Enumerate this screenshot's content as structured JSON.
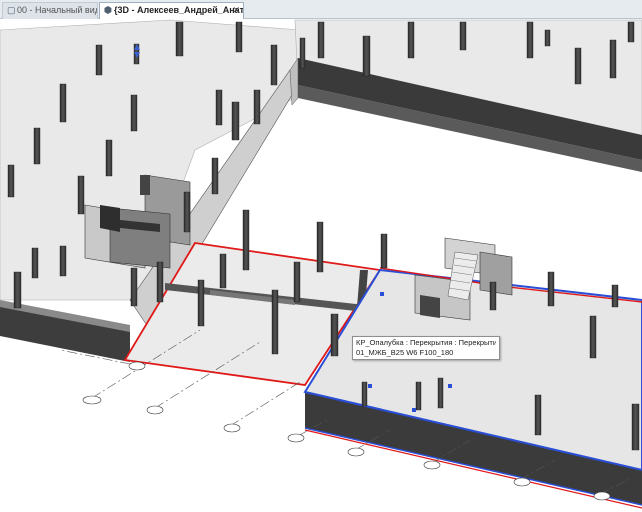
{
  "tabs": [
    {
      "label": "00 - Начальный вид",
      "icon": "view-icon",
      "active": false
    },
    {
      "label": "{3D - Алексеев_Андрей_Анатол...",
      "icon": "3d-view-icon",
      "active": true
    }
  ],
  "tooltip": {
    "line1": "КР_Опалубка : Перекрытия : Перекрытие :",
    "line2": "01_МЖБ_B25 W6 F100_180"
  },
  "colors": {
    "selection_red": "#e01818",
    "highlight_blue": "#2a4fd6",
    "wall_dark": "#3d3d3d",
    "slab": "#e9e9e9"
  }
}
